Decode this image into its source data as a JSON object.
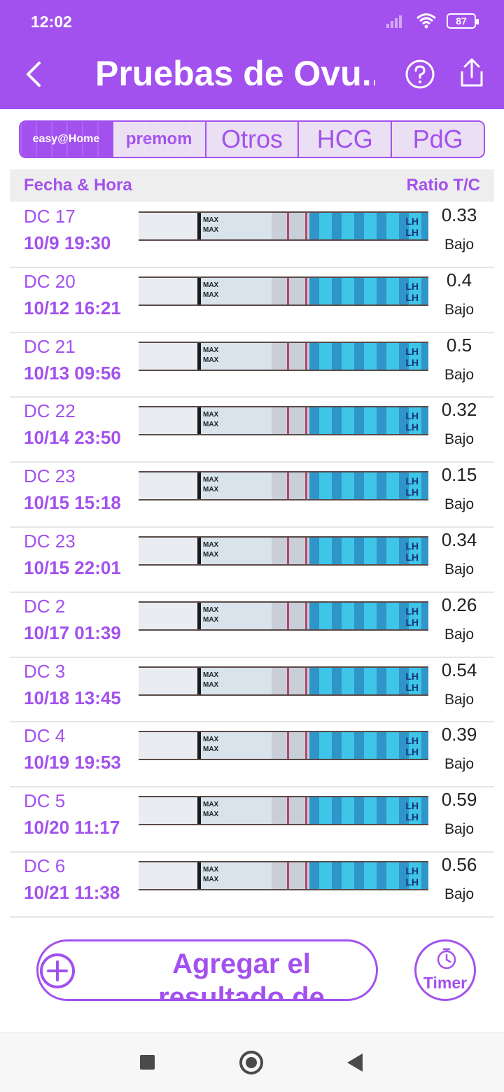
{
  "status_bar": {
    "time": "12:02",
    "battery": "87"
  },
  "app_bar": {
    "title": "Pruebas de Ovu..."
  },
  "brand_tabs": [
    {
      "label": "easy@Home",
      "active": true
    },
    {
      "label": "premom",
      "active": false
    },
    {
      "label": "Otros",
      "active": false
    },
    {
      "label": "HCG",
      "active": false
    },
    {
      "label": "PdG",
      "active": false
    }
  ],
  "list_header": {
    "date_col": "Fecha & Hora",
    "ratio_col": "Ratio T/C"
  },
  "strip_text": {
    "max": "MAX",
    "lh": "LH"
  },
  "rows": [
    {
      "dc": "DC 17",
      "datetime": "10/9  19:30",
      "ratio": "0.33",
      "level": "Bajo"
    },
    {
      "dc": "DC 20",
      "datetime": "10/12  16:21",
      "ratio": "0.4",
      "level": "Bajo"
    },
    {
      "dc": "DC 21",
      "datetime": "10/13  09:56",
      "ratio": "0.5",
      "level": "Bajo"
    },
    {
      "dc": "DC 22",
      "datetime": "10/14  23:50",
      "ratio": "0.32",
      "level": "Bajo"
    },
    {
      "dc": "DC 23",
      "datetime": "10/15  15:18",
      "ratio": "0.15",
      "level": "Bajo"
    },
    {
      "dc": "DC 23",
      "datetime": "10/15  22:01",
      "ratio": "0.34",
      "level": "Bajo"
    },
    {
      "dc": "DC 2",
      "datetime": "10/17  01:39",
      "ratio": "0.26",
      "level": "Bajo"
    },
    {
      "dc": "DC 3",
      "datetime": "10/18  13:45",
      "ratio": "0.54",
      "level": "Bajo"
    },
    {
      "dc": "DC 4",
      "datetime": "10/19  19:53",
      "ratio": "0.39",
      "level": "Bajo"
    },
    {
      "dc": "DC 5",
      "datetime": "10/20  11:17",
      "ratio": "0.59",
      "level": "Bajo"
    },
    {
      "dc": "DC 6",
      "datetime": "10/21  11:38",
      "ratio": "0.56",
      "level": "Bajo"
    }
  ],
  "add_button": {
    "label": "Agregar el resultado de"
  },
  "timer_button": {
    "label": "Timer"
  },
  "colors": {
    "accent": "#a351ee",
    "tab_inactive_bg": "#eadff3",
    "strip_blue": "#3ec5e8",
    "test_line": "#b04a6a"
  },
  "icons": [
    "back-arrow-icon",
    "help-circle-icon",
    "share-icon",
    "plus-circle-icon",
    "stopwatch-icon",
    "wifi-icon",
    "signal-icon",
    "battery-icon"
  ]
}
